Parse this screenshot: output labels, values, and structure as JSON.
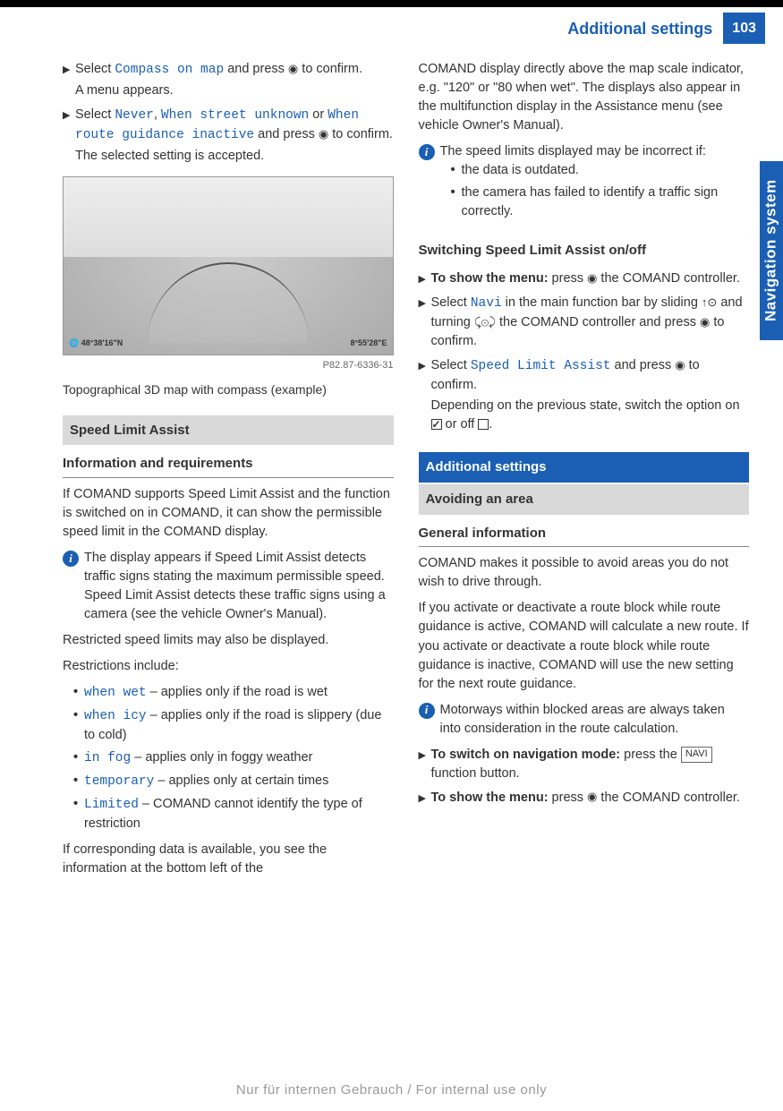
{
  "header": {
    "title": "Additional settings",
    "page": "103"
  },
  "sideTab": "Navigation system",
  "left": {
    "step1": {
      "a": "Select ",
      "ui": "Compass on map",
      "b": " and press ",
      "c": " to confirm.",
      "d": "A menu appears."
    },
    "step2": {
      "a": "Select ",
      "u1": "Never",
      "sep1": ", ",
      "u2": "When street unknown",
      "sep2": " or ",
      "u3": "When route guidance inactive",
      "b": " and press ",
      "c": " to confirm.",
      "d": "The selected setting is accepted."
    },
    "figCoordL": "🌐 48°38'16\"N",
    "figCoordR": "8°55'28\"E",
    "figLabel": "P82.87-6336-31",
    "caption": "Topographical 3D map with compass (example)",
    "h2": "Speed Limit Assist",
    "h3": "Information and requirements",
    "p1": "If COMAND supports Speed Limit Assist and the function is switched on in COMAND, it can show the permissible speed limit in the COMAND display.",
    "info1": "The display appears if Speed Limit Assist detects traffic signs stating the maximum permissible speed. Speed Limit Assist detects these traffic signs using a camera (see the vehicle Owner's Manual).",
    "p2": "Restricted speed limits may also be displayed.",
    "p3": "Restrictions include:",
    "r1u": "when wet",
    "r1t": " – applies only if the road is wet",
    "r2u": "when icy",
    "r2t": " – applies only if the road is slippery (due to cold)",
    "r3u": "in fog",
    "r3t": " – applies only in foggy weather",
    "r4u": "temporary",
    "r4t": " – applies only at certain times",
    "r5u": "Limited",
    "r5t": " – COMAND cannot identify the type of restriction",
    "p4": "If corresponding data is available, you see the information at the bottom left of the"
  },
  "right": {
    "p1": "COMAND display directly above the map scale indicator, e.g. \"120\" or \"80 when wet\". The displays also appear in the multifunction display in the Assistance menu (see vehicle Owner's Manual).",
    "info1": "The speed limits displayed may be incorrect if:",
    "i1a": "the data is outdated.",
    "i1b": "the camera has failed to identify a traffic sign correctly.",
    "h3a": "Switching Speed Limit Assist on/off",
    "s1a": "To show the menu:",
    "s1b": " press ",
    "s1c": " the COMAND controller.",
    "s2a": "Select ",
    "s2u": "Navi",
    "s2b": " in the main function bar by sliding ",
    "s2c": " and turning ",
    "s2d": " the COMAND controller and press ",
    "s2e": " to confirm.",
    "s3a": "Select ",
    "s3u": "Speed Limit Assist",
    "s3b": " and press ",
    "s3c": " to confirm.",
    "s3d": "Depending on the previous state, switch the option on ",
    "s3e": " or off ",
    "s3f": ".",
    "h2blue": "Additional settings",
    "h2grey": "Avoiding an area",
    "h3b": "General information",
    "p2": "COMAND makes it possible to avoid areas you do not wish to drive through.",
    "p3": "If you activate or deactivate a route block while route guidance is active, COMAND will calculate a new route. If you activate or deactivate a route block while route guidance is inactive, COMAND will use the new setting for the next route guidance.",
    "info2": "Motorways within blocked areas are always taken into consideration in the route calculation.",
    "s4a": "To switch on navigation mode:",
    "s4b": " press the ",
    "s4btn": "NAVI",
    "s4c": " function button.",
    "s5a": "To show the menu:",
    "s5b": " press ",
    "s5c": " the COMAND controller."
  },
  "footer": "Nur für internen Gebrauch / For internal use only"
}
